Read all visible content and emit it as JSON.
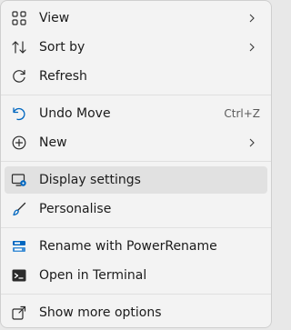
{
  "menu": {
    "items": {
      "view": {
        "label": "View",
        "icon": "grid-view-icon",
        "has_submenu": true
      },
      "sort_by": {
        "label": "Sort by",
        "icon": "sort-arrows-icon",
        "has_submenu": true
      },
      "refresh": {
        "label": "Refresh",
        "icon": "refresh-icon"
      },
      "undo_move": {
        "label": "Undo Move",
        "icon": "undo-icon",
        "shortcut": "Ctrl+Z"
      },
      "new": {
        "label": "New",
        "icon": "add-circle-icon",
        "has_submenu": true
      },
      "display_settings": {
        "label": "Display settings",
        "icon": "display-settings-icon",
        "highlighted": true
      },
      "personalise": {
        "label": "Personalise",
        "icon": "paintbrush-icon"
      },
      "rename_powerrename": {
        "label": "Rename with PowerRename",
        "icon": "powerrename-icon"
      },
      "open_terminal": {
        "label": "Open in Terminal",
        "icon": "terminal-icon"
      },
      "show_more_options": {
        "label": "Show more options",
        "icon": "share-options-icon"
      }
    }
  },
  "colors": {
    "menu_background": "#f3f3f3",
    "hover_background": "#e1e1e1",
    "text": "#1b1b1b",
    "accent_blue": "#0067c0"
  }
}
